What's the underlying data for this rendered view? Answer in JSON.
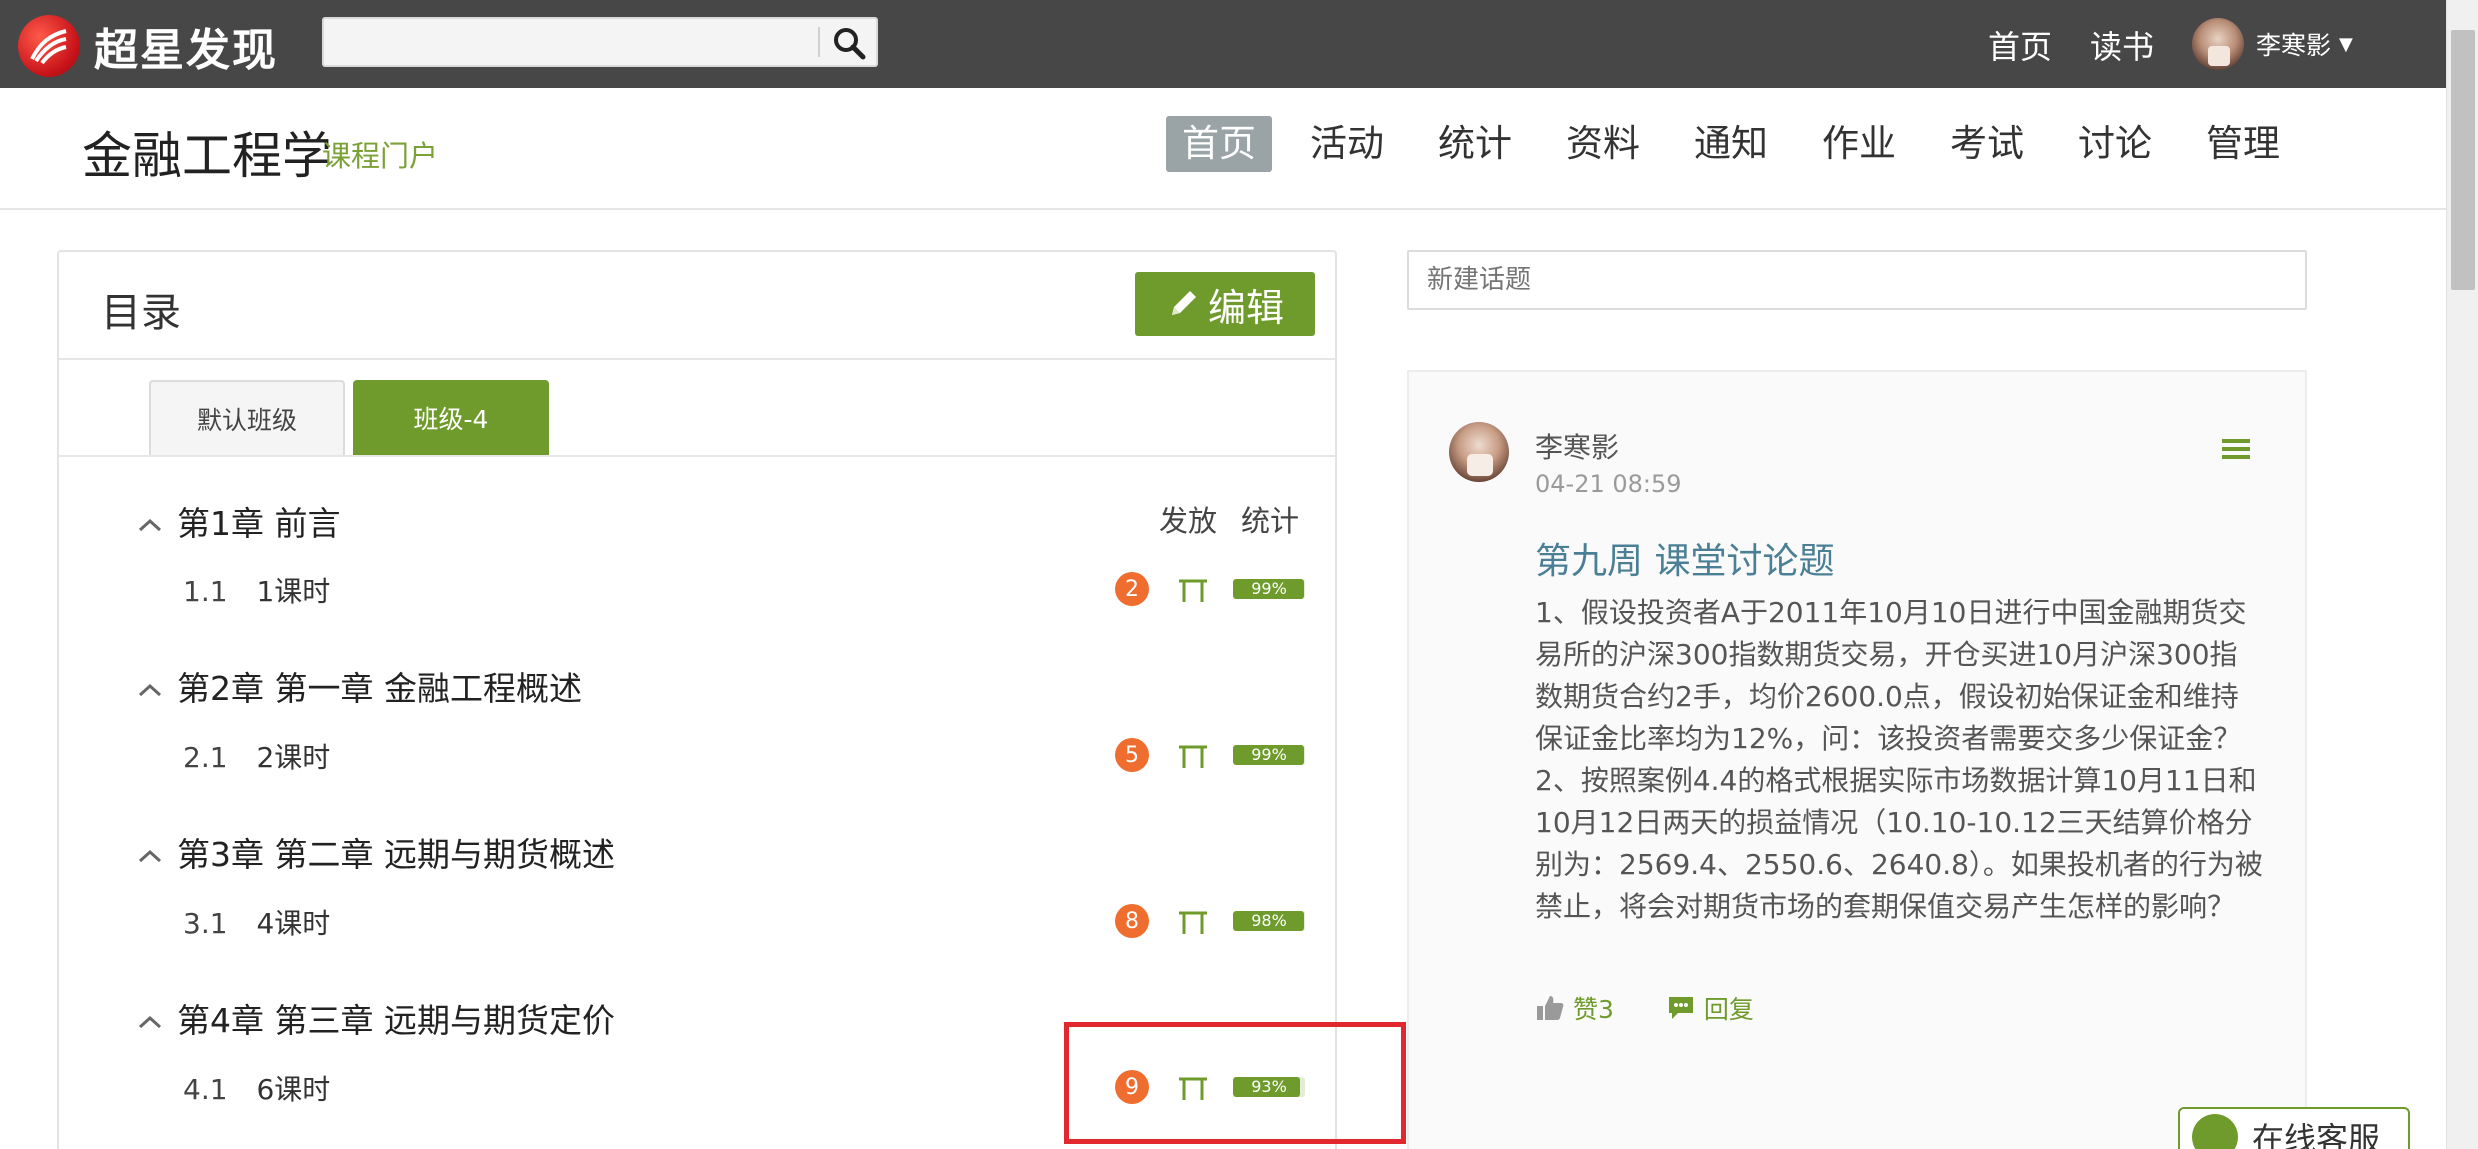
{
  "topbar": {
    "brand": "超星发现",
    "search": {
      "value": "",
      "placeholder": ""
    },
    "links": {
      "home": "首页",
      "reading": "读书"
    },
    "user": {
      "name": "李寒影"
    }
  },
  "course": {
    "title": "金融工程学",
    "subtitle": "课程门户",
    "nav": [
      "首页",
      "活动",
      "统计",
      "资料",
      "通知",
      "作业",
      "考试",
      "讨论",
      "管理"
    ],
    "active_nav": "首页"
  },
  "catalog": {
    "title": "目录",
    "edit_label": "编辑",
    "tabs": {
      "default": "默认班级",
      "active": "班级-4"
    },
    "columns": {
      "release": "发放",
      "stats": "统计"
    },
    "chapters": [
      {
        "title": "第1章 前言",
        "lesson_num": "1.1",
        "lesson_title": "1课时",
        "badge": "2",
        "progress_label": "99%",
        "progress": 0.99
      },
      {
        "title": "第2章 第一章 金融工程概述",
        "lesson_num": "2.1",
        "lesson_title": "2课时",
        "badge": "5",
        "progress_label": "99%",
        "progress": 0.99
      },
      {
        "title": "第3章 第二章 远期与期货概述",
        "lesson_num": "3.1",
        "lesson_title": "4课时",
        "badge": "8",
        "progress_label": "98%",
        "progress": 0.98
      },
      {
        "title": "第4章 第三章 远期与期货定价",
        "lesson_num": "4.1",
        "lesson_title": "6课时",
        "badge": "9",
        "progress_label": "93%",
        "progress": 0.93
      }
    ]
  },
  "discussion": {
    "new_topic_placeholder": "新建话题",
    "post": {
      "author": "李寒影",
      "time": "04-21 08:59",
      "title": "第九周 课堂讨论题",
      "body": [
        "1、假设投资者A于2011年10月10日进行中国金融期货交易所的沪深300指数期货交易，开仓买进10月沪深300指数期货合约2手，均价2600.0点，假设初始保证金和维持保证金比率均为12%，问：该投资者需要交多少保证金？",
        "2、按照案例4.4的格式根据实际市场数据计算10月11日和10月12日两天的损益情况（10.10-10.12三天结算价格分别为：2569.4、2550.6、2640.8）。如果投机者的行为被禁止，将会对期货市场的套期保值交易产生怎样的影响？"
      ],
      "like_label": "赞3",
      "reply_label": "回复"
    },
    "service_label": "在线客服"
  },
  "colors": {
    "topbar": "#474747",
    "accent_green": "#6f9b2c",
    "badge_orange": "#ef6d2f",
    "highlight_red": "#e0282e",
    "post_title": "#4a7f95"
  }
}
